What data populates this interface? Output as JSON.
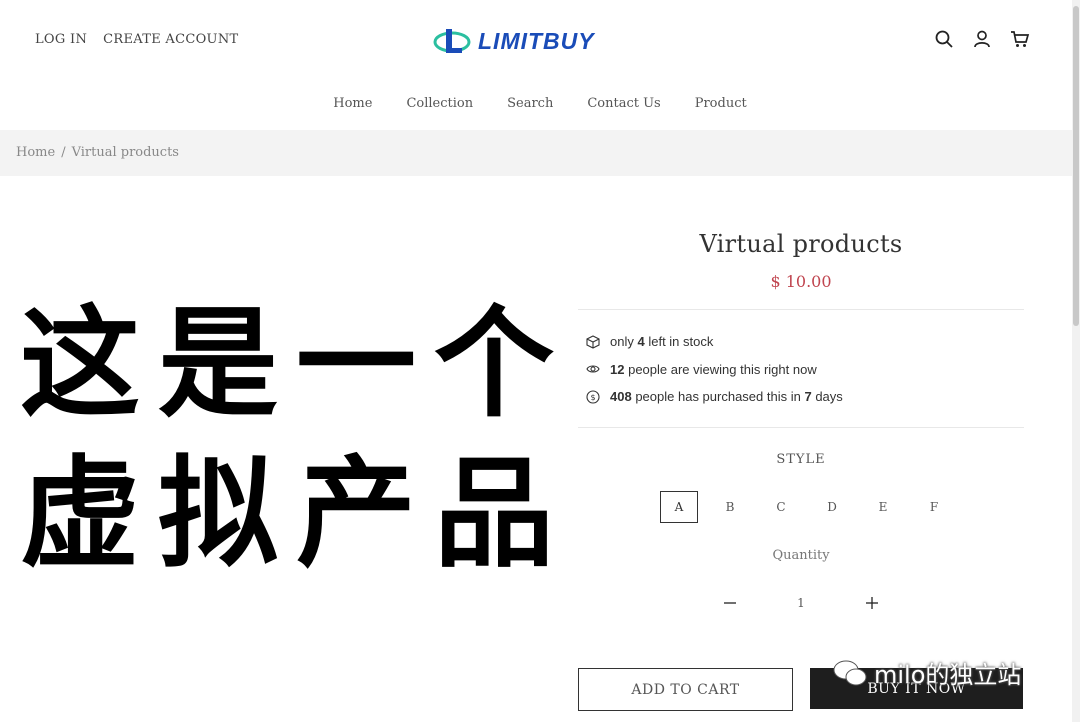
{
  "header": {
    "login": "LOG IN",
    "create_account": "CREATE ACCOUNT",
    "logo_text": "LIMITBUY",
    "icons": [
      "search-icon",
      "user-icon",
      "cart-icon"
    ]
  },
  "nav": {
    "items": [
      "Home",
      "Collection",
      "Search",
      "Contact Us",
      "Product"
    ]
  },
  "breadcrumb": {
    "home": "Home",
    "separator": "/",
    "current": "Virtual products"
  },
  "product_image": {
    "line1": "这是一个",
    "line2": "虚拟产品"
  },
  "product": {
    "title": "Virtual products",
    "price": "$ 10.00",
    "price_color": "#c0454f",
    "stats": {
      "stock_prefix": "only",
      "stock_count": "4",
      "stock_suffix": "left in stock",
      "viewing_count": "12",
      "viewing_suffix": "people are viewing this right now",
      "purchased_count": "408",
      "purchased_middle": "people has purchased this in",
      "purchased_days": "7",
      "purchased_suffix": "days"
    },
    "style_label": "STYLE",
    "styles": [
      "A",
      "B",
      "C",
      "D",
      "E",
      "F"
    ],
    "selected_style": "A",
    "quantity_label": "Quantity",
    "quantity": "1",
    "add_to_cart": "ADD TO CART",
    "buy_now": "BUY IT NOW"
  },
  "watermark": {
    "text": "milo的独立站"
  }
}
